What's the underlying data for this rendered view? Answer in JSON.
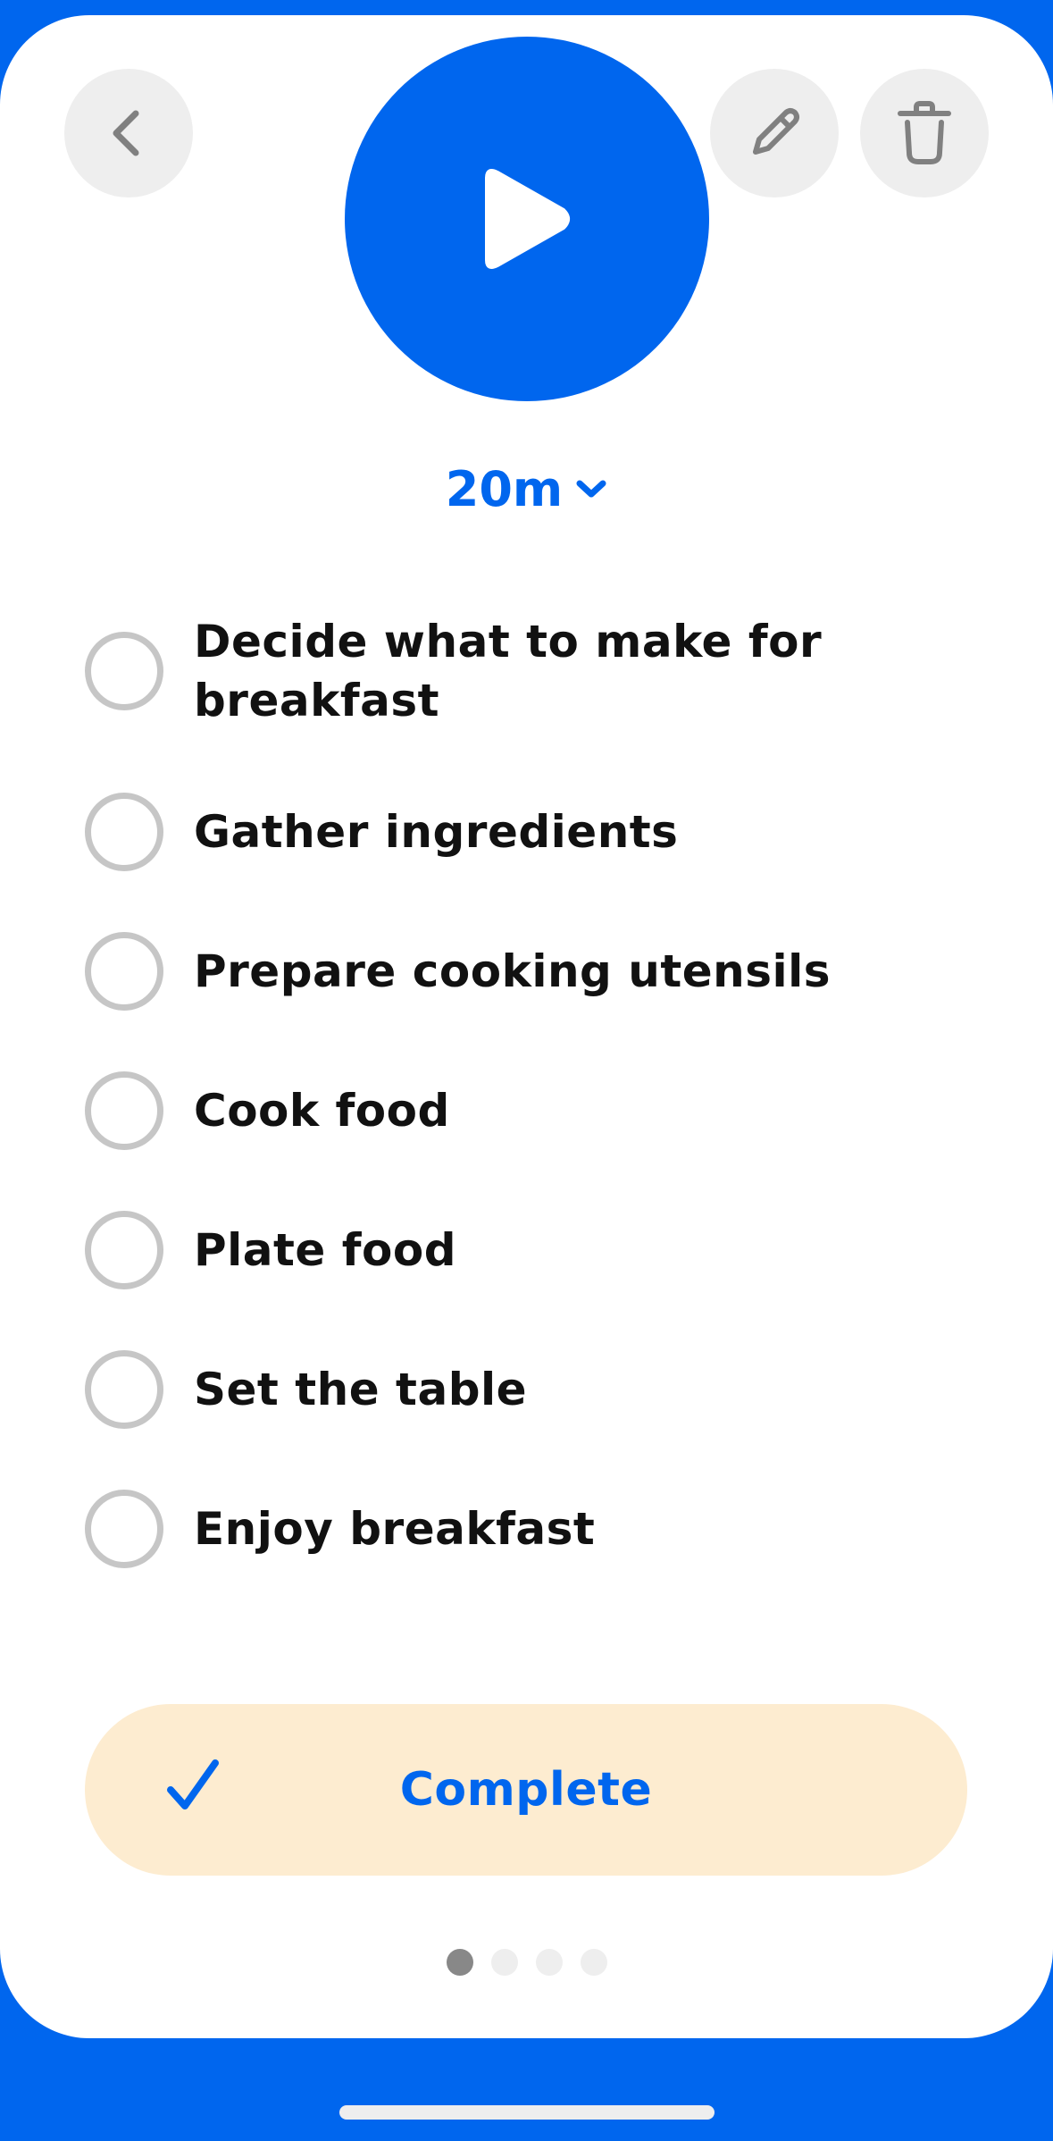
{
  "duration": {
    "label": "20m"
  },
  "tasks": [
    {
      "line1": "Decide what to make for",
      "line2": "breakfast",
      "checked": false
    },
    {
      "label": "Gather ingredients",
      "checked": false
    },
    {
      "label": "Prepare cooking utensils",
      "checked": false
    },
    {
      "label": "Cook food",
      "checked": false
    },
    {
      "label": "Plate food",
      "checked": false
    },
    {
      "label": "Set the table",
      "checked": false
    },
    {
      "label": "Enjoy breakfast",
      "checked": false
    }
  ],
  "complete": {
    "label": "Complete"
  },
  "pagination": {
    "current": 1,
    "total": 4
  },
  "icons": {
    "back": "chevron-left-icon",
    "edit": "pencil-icon",
    "delete": "trash-icon",
    "play": "play-icon",
    "duration_dropdown": "chevron-down-icon",
    "complete": "checkmark-icon"
  },
  "colors": {
    "accent": "#0066ee",
    "background": "#ffffff",
    "icon_button_bg": "#eeeeee",
    "icon_gray": "#808080",
    "checkbox_border": "#c6c6c6",
    "complete_bg": "#fdecd0",
    "text": "#111111"
  }
}
